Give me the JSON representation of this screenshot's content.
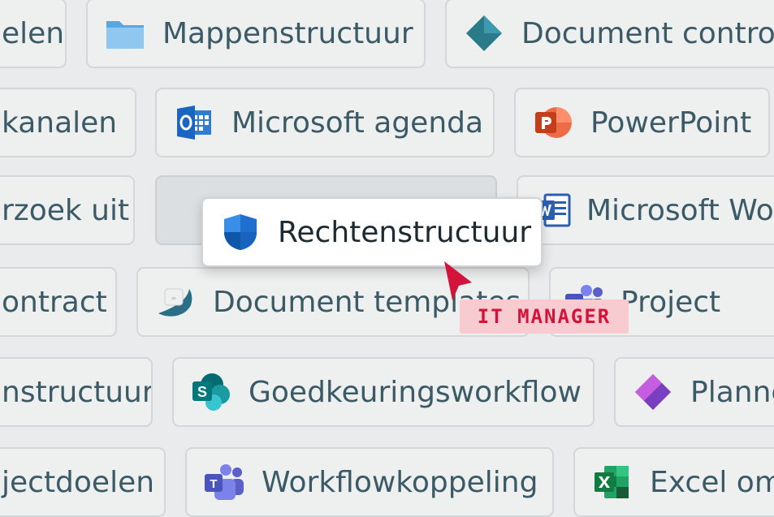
{
  "tiles": {
    "r1c1": "elen",
    "r1c2": "Mappenstructuur",
    "r1c3": "Document control",
    "r2c1": "kanalen",
    "r2c2": "Microsoft agenda",
    "r2c3": "PowerPoint",
    "r3c1": "rzoek uit",
    "r3c3": "Microsoft Word",
    "r4c1": "ontract",
    "r4c2": "Document templates",
    "r4c3": "Project",
    "r5c1": "nstructuur",
    "r5c2": "Goedkeuringsworkflow",
    "r5c3": "Planner",
    "r6c1": "jectdoelen",
    "r6c2": "Workflowkoppeling",
    "r6c3": "Excel om"
  },
  "dragged_tile": {
    "label": "Rechtenstructuur",
    "icon": "shield-icon"
  },
  "cursor_tag": "IT MANAGER",
  "colors": {
    "background": "#e9ebec",
    "tile_text": "#3b5a66",
    "accent_red": "#d3143a",
    "tag_bg": "#f8cbd0"
  }
}
